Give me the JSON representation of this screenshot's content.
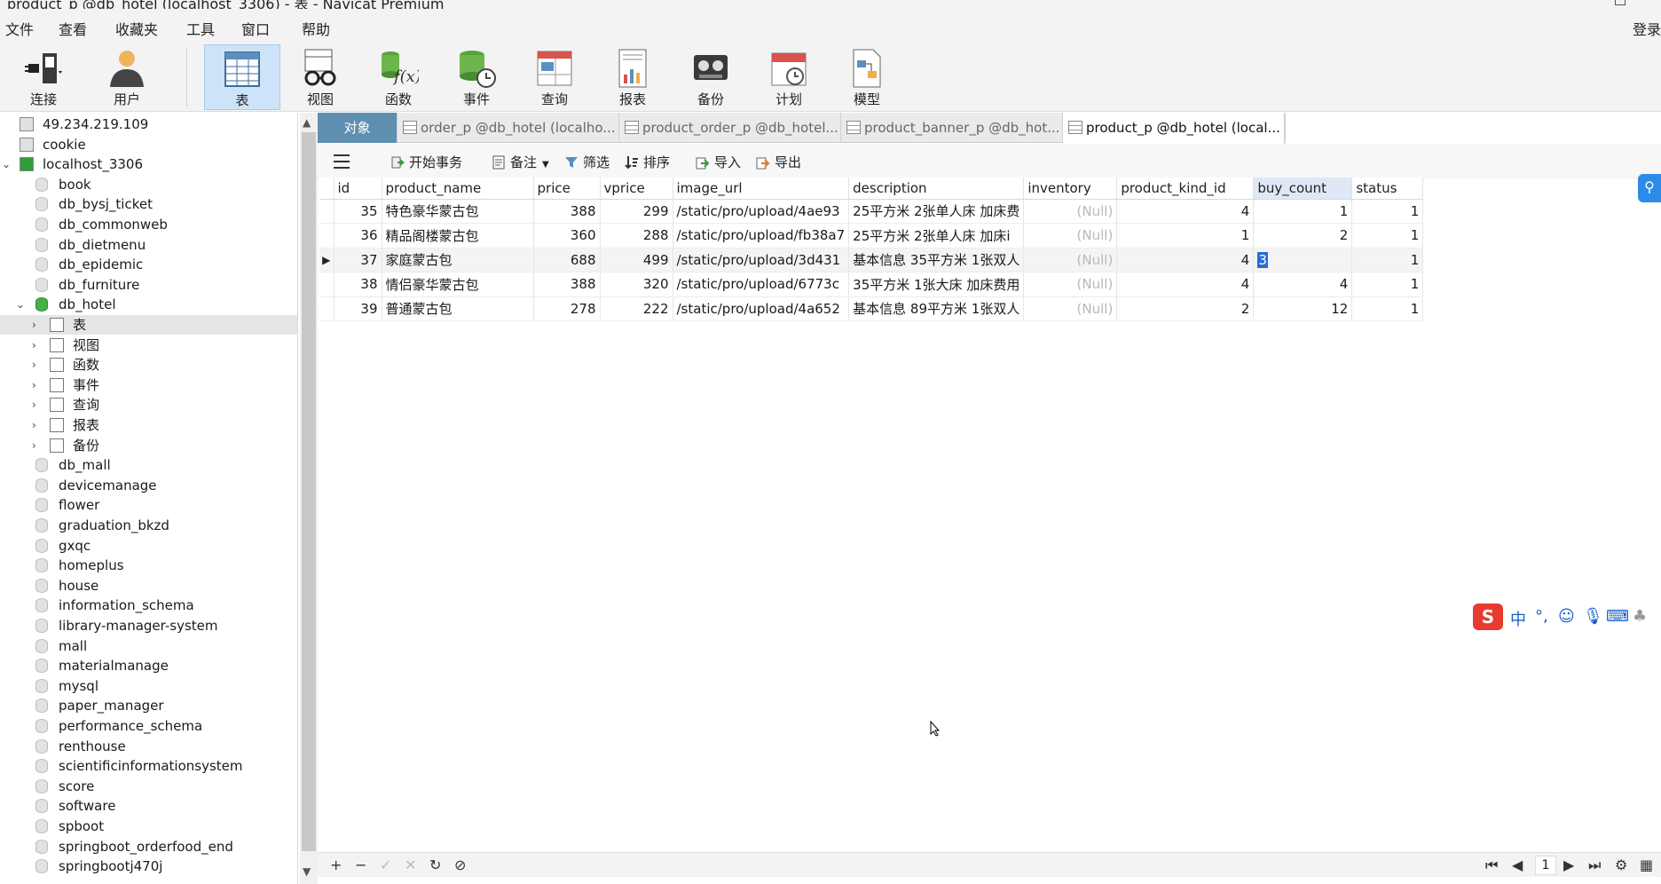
{
  "window": {
    "title": "product_p @db_hotel (localhost_3306) - 表 - Navicat Premium"
  },
  "menu": {
    "items": [
      "文件",
      "查看",
      "收藏夹",
      "工具",
      "窗口",
      "帮助"
    ],
    "login": "登录"
  },
  "ribbon": {
    "buttons": [
      {
        "label": "连接",
        "icon": "plug-icon"
      },
      {
        "label": "用户",
        "icon": "user-icon"
      },
      {
        "label": "表",
        "icon": "table-icon",
        "active": true
      },
      {
        "label": "视图",
        "icon": "view-glasses-icon"
      },
      {
        "label": "函数",
        "icon": "function-icon"
      },
      {
        "label": "事件",
        "icon": "event-clock-icon"
      },
      {
        "label": "查询",
        "icon": "query-icon"
      },
      {
        "label": "报表",
        "icon": "report-icon"
      },
      {
        "label": "备份",
        "icon": "backup-icon"
      },
      {
        "label": "计划",
        "icon": "schedule-calendar-icon"
      },
      {
        "label": "模型",
        "icon": "model-icon"
      }
    ]
  },
  "sidebar": {
    "rows": [
      {
        "label": "49.234.219.109",
        "kind": "connection"
      },
      {
        "label": "cookie",
        "kind": "connection"
      },
      {
        "label": "localhost_3306",
        "kind": "connection-open"
      },
      {
        "label": "book",
        "kind": "db"
      },
      {
        "label": "db_bysj_ticket",
        "kind": "db"
      },
      {
        "label": "db_commonweb",
        "kind": "db"
      },
      {
        "label": "db_dietmenu",
        "kind": "db"
      },
      {
        "label": "db_epidemic",
        "kind": "db"
      },
      {
        "label": "db_furniture",
        "kind": "db"
      },
      {
        "label": "db_hotel",
        "kind": "db-open"
      },
      {
        "label": "表",
        "kind": "node-table"
      },
      {
        "label": "视图",
        "kind": "node-view"
      },
      {
        "label": "函数",
        "kind": "node-func"
      },
      {
        "label": "事件",
        "kind": "node-event"
      },
      {
        "label": "查询",
        "kind": "node-query"
      },
      {
        "label": "报表",
        "kind": "node-report"
      },
      {
        "label": "备份",
        "kind": "node-backup"
      },
      {
        "label": "db_mall",
        "kind": "db"
      },
      {
        "label": "devicemanage",
        "kind": "db"
      },
      {
        "label": "flower",
        "kind": "db"
      },
      {
        "label": "graduation_bkzd",
        "kind": "db"
      },
      {
        "label": "gxqc",
        "kind": "db"
      },
      {
        "label": "homeplus",
        "kind": "db"
      },
      {
        "label": "house",
        "kind": "db"
      },
      {
        "label": "information_schema",
        "kind": "db"
      },
      {
        "label": "library-manager-system",
        "kind": "db"
      },
      {
        "label": "mall",
        "kind": "db"
      },
      {
        "label": "materialmanage",
        "kind": "db"
      },
      {
        "label": "mysql",
        "kind": "db"
      },
      {
        "label": "paper_manager",
        "kind": "db"
      },
      {
        "label": "performance_schema",
        "kind": "db"
      },
      {
        "label": "renthouse",
        "kind": "db"
      },
      {
        "label": "scientificinformationsystem",
        "kind": "db"
      },
      {
        "label": "score",
        "kind": "db"
      },
      {
        "label": "software",
        "kind": "db"
      },
      {
        "label": "spboot",
        "kind": "db"
      },
      {
        "label": "springboot_orderfood_end",
        "kind": "db"
      },
      {
        "label": "springbootj470j",
        "kind": "db"
      }
    ]
  },
  "tabs": {
    "objects": "对象",
    "items": [
      "order_p @db_hotel (localho...",
      "product_order_p @db_hotel...",
      "product_banner_p @db_hot...",
      "product_p @db_hotel (local..."
    ]
  },
  "gridtools": {
    "begin_tx": "开始事务",
    "note": "备注",
    "filter": "筛选",
    "sort": "排序",
    "import": "导入",
    "export": "导出"
  },
  "table": {
    "columns": [
      "id",
      "product_name",
      "price",
      "vprice",
      "image_url",
      "description",
      "inventory",
      "product_kind_id",
      "buy_count",
      "status"
    ],
    "rows": [
      [
        "35",
        "特色豪华蒙古包",
        "388",
        "299",
        "/static/pro/upload/4ae93",
        "25平方米 2张单人床  加床费",
        "(Null)",
        "4",
        "1",
        "1"
      ],
      [
        "36",
        "精品阁楼蒙古包",
        "360",
        "288",
        "/static/pro/upload/fb38a7",
        "25平方米 2张单人床  加床i",
        "(Null)",
        "1",
        "2",
        "1"
      ],
      [
        "37",
        "家庭蒙古包",
        "688",
        "499",
        "/static/pro/upload/3d431",
        "基本信息 35平方米 1张双人",
        "(Null)",
        "4",
        "3",
        "1"
      ],
      [
        "38",
        "情侣豪华蒙古包",
        "388",
        "320",
        "/static/pro/upload/6773c",
        "35平方米 1张大床  加床费用",
        "(Null)",
        "4",
        "4",
        "1"
      ],
      [
        "39",
        "普通蒙古包",
        "278",
        "222",
        "/static/pro/upload/4a652",
        "基本信息 89平方米 1张双人",
        "(Null)",
        "2",
        "12",
        "1"
      ]
    ]
  },
  "bottombar": {
    "page": "1"
  },
  "ime": {
    "lang": "中"
  }
}
